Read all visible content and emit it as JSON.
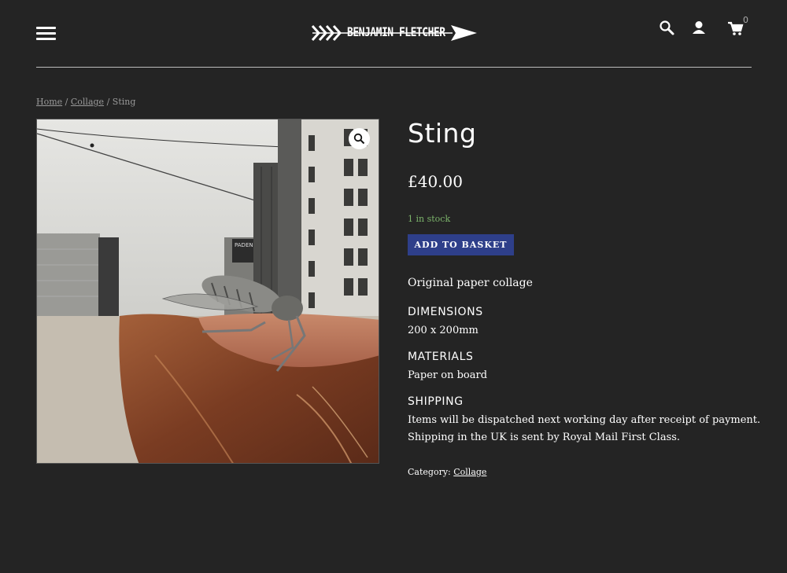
{
  "header": {
    "logo_text": "BENJAMIN FLETCHER",
    "cart_count": "0"
  },
  "breadcrumb": {
    "home": "Home",
    "separator": "/",
    "category": "Collage",
    "current": "Sting"
  },
  "product": {
    "title": "Sting",
    "price": "£40.00",
    "stock": "1 in stock",
    "add_to_basket": "ADD TO BASKET",
    "description_lead": "Original paper collage",
    "sections": [
      {
        "heading": "DIMENSIONS",
        "text": "200 x 200mm"
      },
      {
        "heading": "MATERIALS",
        "text": "Paper on board"
      },
      {
        "heading": "SHIPPING",
        "text_line1": "Items will be dispatched next working day after receipt of payment.",
        "text_line2": "Shipping in the UK is sent by Royal Mail First Class."
      }
    ],
    "category_label": "Category:",
    "category_value": "Collage",
    "image_sign_text": "PADEN-F"
  },
  "colors": {
    "background": "#242424",
    "button": "#2e3f8a",
    "stock": "#7bb36a"
  }
}
